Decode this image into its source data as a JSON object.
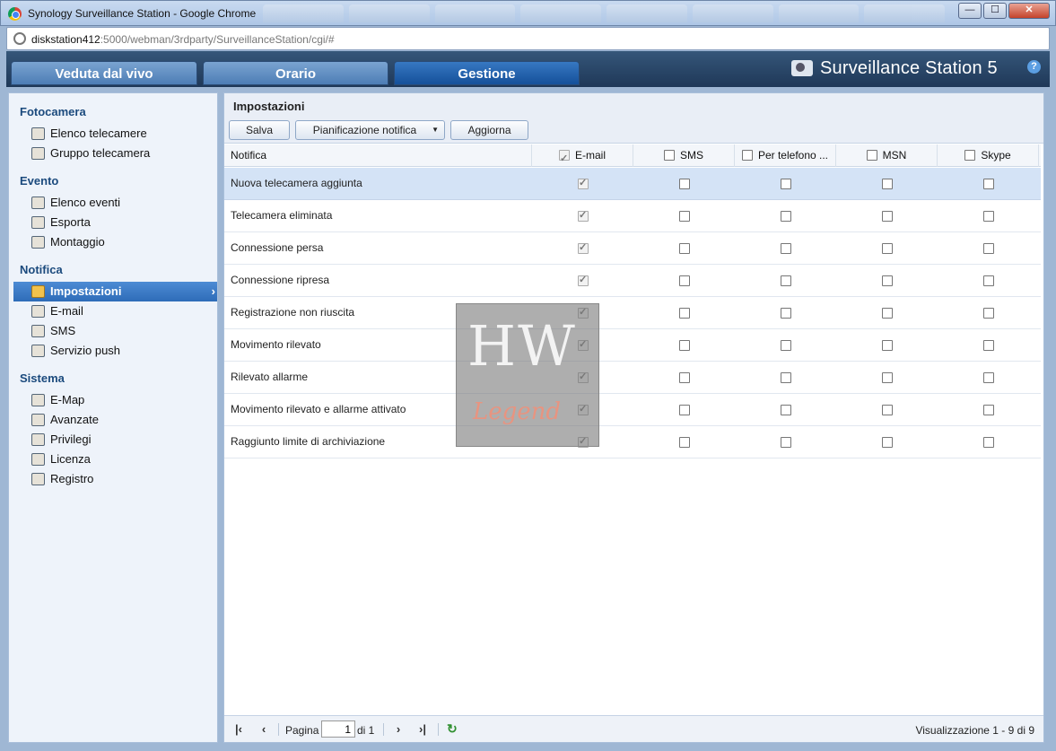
{
  "browser": {
    "title": "Synology Surveillance Station - Google Chrome",
    "url_host": "diskstation412",
    "url_rest": ":5000/webman/3rdparty/SurveillanceStation/cgi/#",
    "controls": {
      "minimize": "—",
      "maximize": "☐",
      "close": "✕"
    }
  },
  "header": {
    "tabs": [
      "Veduta dal vivo",
      "Orario",
      "Gestione"
    ],
    "active_tab": "Gestione",
    "brand": "Surveillance Station 5",
    "help": "?"
  },
  "sidebar": {
    "sections": [
      {
        "title": "Fotocamera",
        "items": [
          {
            "label": "Elenco telecamere",
            "icon": "camera-icon"
          },
          {
            "label": "Gruppo telecamera",
            "icon": "folder-camera-icon"
          }
        ]
      },
      {
        "title": "Evento",
        "items": [
          {
            "label": "Elenco eventi",
            "icon": "event-list-icon"
          },
          {
            "label": "Esporta",
            "icon": "export-icon"
          },
          {
            "label": "Montaggio",
            "icon": "mount-icon"
          }
        ]
      },
      {
        "title": "Notifica",
        "items": [
          {
            "label": "Impostazioni",
            "icon": "wrench-icon",
            "selected": true
          },
          {
            "label": "E-mail",
            "icon": "envelope-icon"
          },
          {
            "label": "SMS",
            "icon": "phone-sms-icon"
          },
          {
            "label": "Servizio push",
            "icon": "mobile-icon"
          }
        ]
      },
      {
        "title": "Sistema",
        "items": [
          {
            "label": "E-Map",
            "icon": "map-icon"
          },
          {
            "label": "Avanzate",
            "icon": "advanced-icon"
          },
          {
            "label": "Privilegi",
            "icon": "users-icon"
          },
          {
            "label": "Licenza",
            "icon": "key-icon"
          },
          {
            "label": "Registro",
            "icon": "book-icon"
          }
        ]
      }
    ]
  },
  "main": {
    "title": "Impostazioni",
    "toolbar": {
      "save": "Salva",
      "schedule": "Pianificazione notifica",
      "refresh": "Aggiorna"
    },
    "columns": [
      "Notifica",
      "E-mail",
      "SMS",
      "Per telefono ...",
      "MSN",
      "Skype"
    ],
    "header_checked": [
      true,
      false,
      false,
      false,
      false
    ],
    "rows": [
      {
        "label": "Nuova telecamera aggiunta",
        "email": true,
        "sms": false,
        "phone": false,
        "msn": false,
        "skype": false,
        "selected": true
      },
      {
        "label": "Telecamera eliminata",
        "email": true,
        "sms": false,
        "phone": false,
        "msn": false,
        "skype": false
      },
      {
        "label": "Connessione persa",
        "email": true,
        "sms": false,
        "phone": false,
        "msn": false,
        "skype": false
      },
      {
        "label": "Connessione ripresa",
        "email": true,
        "sms": false,
        "phone": false,
        "msn": false,
        "skype": false
      },
      {
        "label": "Registrazione non riuscita",
        "email": true,
        "sms": false,
        "phone": false,
        "msn": false,
        "skype": false
      },
      {
        "label": "Movimento rilevato",
        "email": true,
        "sms": false,
        "phone": false,
        "msn": false,
        "skype": false
      },
      {
        "label": "Rilevato allarme",
        "email": true,
        "sms": false,
        "phone": false,
        "msn": false,
        "skype": false
      },
      {
        "label": "Movimento rilevato e allarme attivato",
        "email": true,
        "sms": false,
        "phone": false,
        "msn": false,
        "skype": false
      },
      {
        "label": "Raggiunto limite di archiviazione",
        "email": true,
        "sms": false,
        "phone": false,
        "msn": false,
        "skype": false
      }
    ],
    "pager": {
      "page_label": "Pagina",
      "page_value": "1",
      "of_label": "di 1",
      "summary": "Visualizzazione 1 - 9 di 9"
    }
  },
  "watermark": {
    "top": "HW",
    "bottom": "Legend"
  }
}
